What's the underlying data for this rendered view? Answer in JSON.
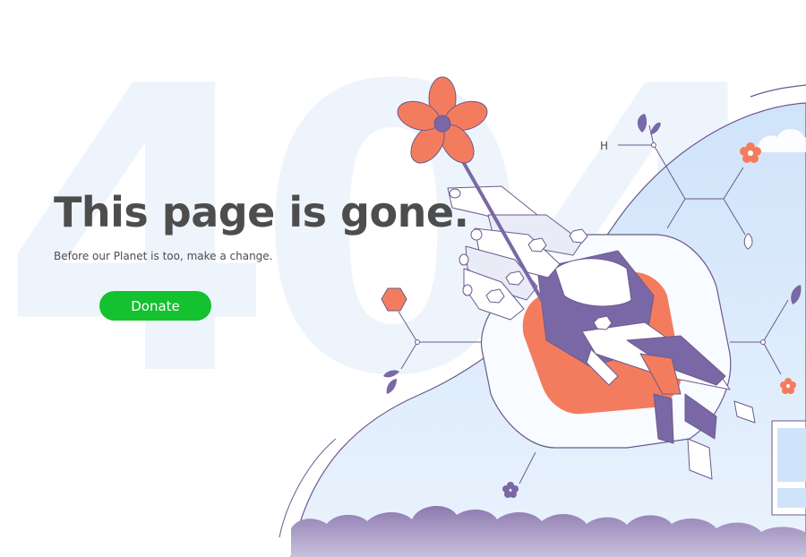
{
  "background": {
    "code": "404"
  },
  "content": {
    "headline": "This page is gone.",
    "subline": "Before our Planet is too, make a change.",
    "donate_label": "Donate"
  },
  "illustration": {
    "molecule_label": "H"
  },
  "colors": {
    "accent_green": "#14c12e",
    "heading_text": "#4d4d4d",
    "coral": "#f47c5e",
    "purple": "#7a68a6",
    "sky_blue": "#d6e8fb",
    "ghost_404": "#eef4fc"
  }
}
